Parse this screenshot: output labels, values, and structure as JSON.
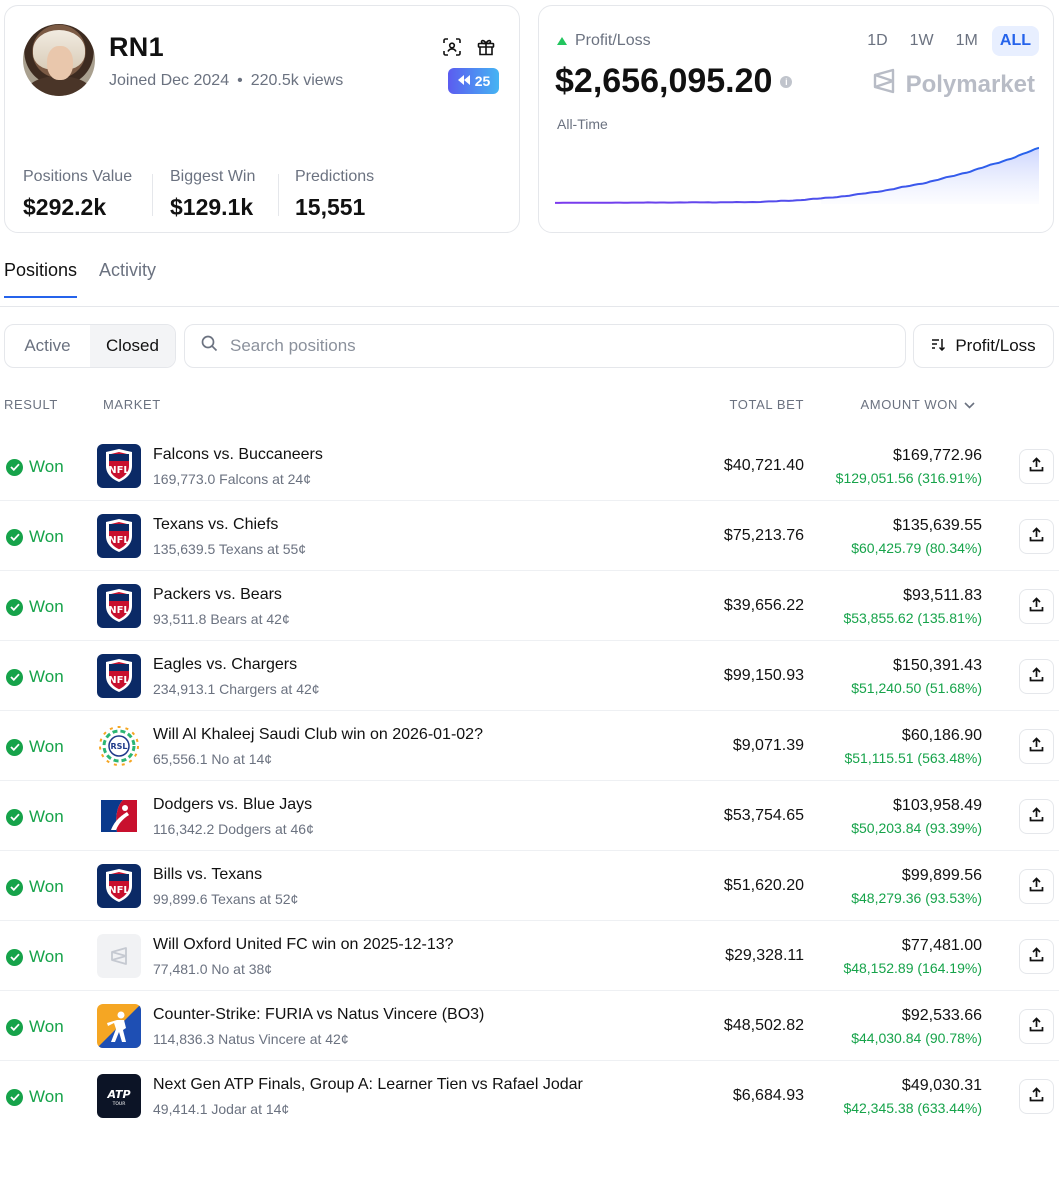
{
  "profile": {
    "username": "RN1",
    "joined": "Joined Dec 2024",
    "views": "220.5k views",
    "badge_count": "25",
    "stats": [
      {
        "label": "Positions Value",
        "value": "$292.2k"
      },
      {
        "label": "Biggest Win",
        "value": "$129.1k"
      },
      {
        "label": "Predictions",
        "value": "15,551"
      }
    ]
  },
  "pnl": {
    "label": "Profit/Loss",
    "value": "$2,656,095.20",
    "period": "All-Time",
    "ranges": [
      "1D",
      "1W",
      "1M",
      "ALL"
    ],
    "active_range": "ALL",
    "brand": "Polymarket",
    "colors": {
      "line_start": "#7c3aed",
      "line_end": "#2563eb",
      "fill": "#c7d2fe"
    }
  },
  "tabs": [
    "Positions",
    "Activity"
  ],
  "filter": {
    "segments": [
      "Active",
      "Closed"
    ],
    "selected": "Closed",
    "search_placeholder": "Search positions",
    "sort_label": "Profit/Loss"
  },
  "table": {
    "headers": {
      "result": "RESULT",
      "market": "MARKET",
      "total_bet": "TOTAL BET",
      "amount_won": "AMOUNT WON"
    },
    "rows": [
      {
        "result": "Won",
        "icon": "nfl-logo",
        "title": "Falcons vs. Buccaneers",
        "sub": "169,773.0 Falcons at 24¢",
        "total": "$40,721.40",
        "won": "$169,772.96",
        "gain": "$129,051.56 (316.91%)"
      },
      {
        "result": "Won",
        "icon": "nfl-logo",
        "title": "Texans vs. Chiefs",
        "sub": "135,639.5 Texans at 55¢",
        "total": "$75,213.76",
        "won": "$135,639.55",
        "gain": "$60,425.79 (80.34%)"
      },
      {
        "result": "Won",
        "icon": "nfl-logo",
        "title": "Packers vs. Bears",
        "sub": "93,511.8 Bears at 42¢",
        "total": "$39,656.22",
        "won": "$93,511.83",
        "gain": "$53,855.62 (135.81%)"
      },
      {
        "result": "Won",
        "icon": "nfl-logo",
        "title": "Eagles vs. Chargers",
        "sub": "234,913.1 Chargers at 42¢",
        "total": "$99,150.93",
        "won": "$150,391.43",
        "gain": "$51,240.50 (51.68%)"
      },
      {
        "result": "Won",
        "icon": "rsl-logo",
        "title": "Will Al Khaleej Saudi Club win on 2026-01-02?",
        "sub": "65,556.1 No at 14¢",
        "total": "$9,071.39",
        "won": "$60,186.90",
        "gain": "$51,115.51 (563.48%)"
      },
      {
        "result": "Won",
        "icon": "mlb-logo",
        "title": "Dodgers vs. Blue Jays",
        "sub": "116,342.2 Dodgers at 46¢",
        "total": "$53,754.65",
        "won": "$103,958.49",
        "gain": "$50,203.84 (93.39%)"
      },
      {
        "result": "Won",
        "icon": "nfl-logo",
        "title": "Bills vs. Texans",
        "sub": "99,899.6 Texans at 52¢",
        "total": "$51,620.20",
        "won": "$99,899.56",
        "gain": "$48,279.36 (93.53%)"
      },
      {
        "result": "Won",
        "icon": "polymarket-logo",
        "title": "Will Oxford United FC win on 2025-12-13?",
        "sub": "77,481.0 No at 38¢",
        "total": "$29,328.11",
        "won": "$77,481.00",
        "gain": "$48,152.89 (164.19%)"
      },
      {
        "result": "Won",
        "icon": "counter-strike-logo",
        "title": "Counter-Strike: FURIA vs Natus Vincere (BO3)",
        "sub": "114,836.3 Natus Vincere at 42¢",
        "total": "$48,502.82",
        "won": "$92,533.66",
        "gain": "$44,030.84 (90.78%)"
      },
      {
        "result": "Won",
        "icon": "atp-logo",
        "title": "Next Gen ATP Finals, Group A: Learner Tien vs Rafael Jodar",
        "sub": "49,414.1 Jodar at 14¢",
        "total": "$6,684.93",
        "won": "$49,030.31",
        "gain": "$42,345.38 (633.44%)"
      }
    ]
  },
  "icons": {
    "rsl_text": "RSL",
    "nfl_text": "NFL",
    "atp_text": "ATP",
    "atp_sub": "TOUR"
  }
}
